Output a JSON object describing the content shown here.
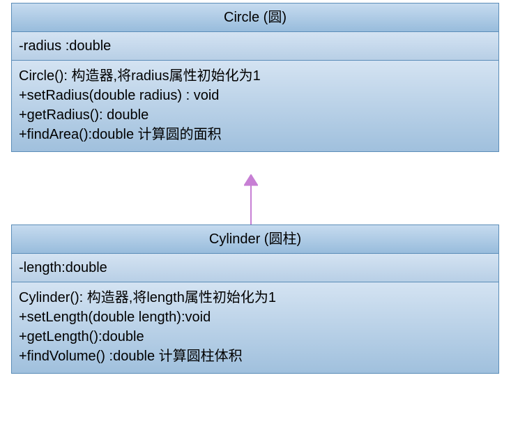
{
  "classes": {
    "circle": {
      "title": "Circle  (圆)",
      "attributes": "-radius :double",
      "methods": [
        "Circle(): 构造器,将radius属性初始化为1",
        "+setRadius(double radius) : void",
        "+getRadius(): double",
        "+findArea():double  计算圆的面积"
      ]
    },
    "cylinder": {
      "title": "Cylinder  (圆柱)",
      "attributes": "-length:double",
      "methods": [
        "Cylinder():  构造器,将length属性初始化为1",
        "+setLength(double length):void",
        "+getLength():double",
        "+findVolume() :double   计算圆柱体积"
      ]
    }
  },
  "relationship": {
    "type": "inheritance",
    "from": "cylinder",
    "to": "circle"
  }
}
